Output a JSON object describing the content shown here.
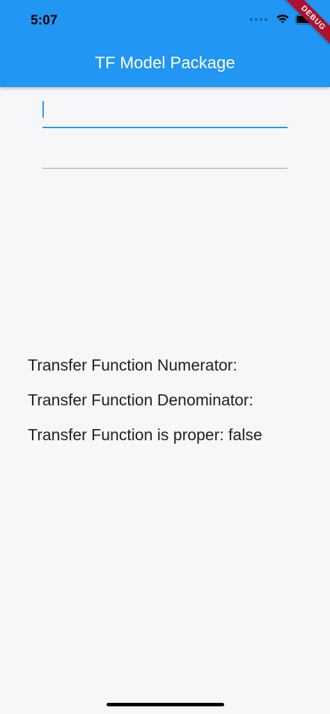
{
  "status_bar": {
    "time": "5:07"
  },
  "app_bar": {
    "title": "TF Model Package",
    "debug_banner": "DEBUG",
    "color": "#2196f3"
  },
  "form": {
    "numerator_field": {
      "value": "",
      "placeholder": ""
    },
    "denominator_field": {
      "value": "",
      "placeholder": ""
    }
  },
  "results": {
    "numerator_label": "Transfer Function Numerator:",
    "denominator_label": "Transfer Function Denominator:",
    "proper_label": "Transfer Function is proper: false"
  }
}
